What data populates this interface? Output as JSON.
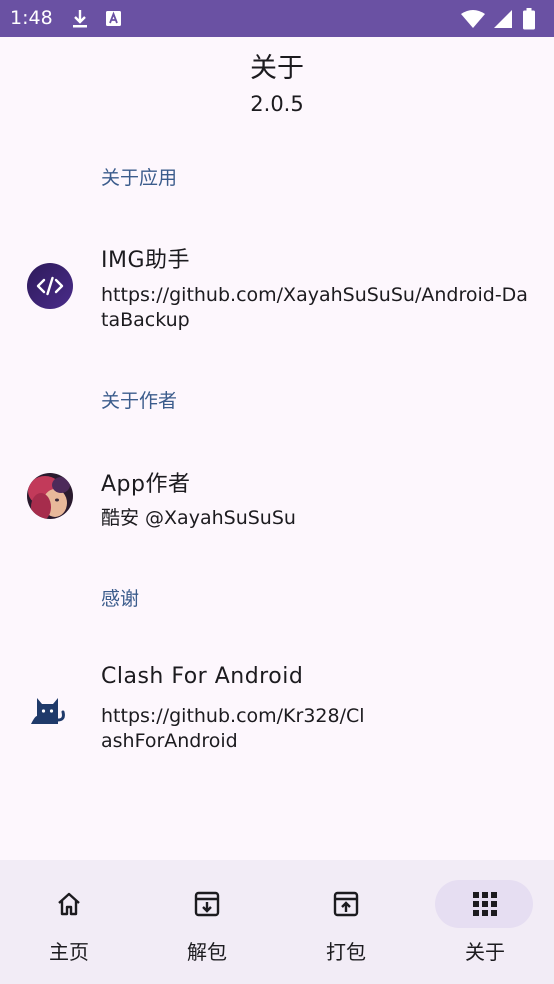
{
  "status_bar": {
    "time": "1:48"
  },
  "header": {
    "title": "关于",
    "version": "2.0.5"
  },
  "sections": [
    {
      "title": "关于应用",
      "item": {
        "title": "IMG助手",
        "subtitle": "https://github.com/XayahSuSuSu/Android-DataBackup",
        "icon": "code-brackets-icon"
      }
    },
    {
      "title": "关于作者",
      "item": {
        "title": "App作者",
        "subtitle": "酷安 @XayahSuSuSu",
        "icon": "author-avatar"
      }
    },
    {
      "title": "感谢",
      "item": {
        "title": "Clash For Android",
        "subtitle": "https://github.com/Kr328/ClashForAndroid",
        "icon": "cat-icon"
      }
    }
  ],
  "bottom_nav": [
    {
      "label": "主页",
      "icon": "home-icon",
      "active": false
    },
    {
      "label": "解包",
      "icon": "archive-down-icon",
      "active": false
    },
    {
      "label": "打包",
      "icon": "archive-up-icon",
      "active": false
    },
    {
      "label": "关于",
      "icon": "apps-grid-icon",
      "active": true
    }
  ],
  "colors": {
    "status_bar": "#6a51a3",
    "section_title": "#3b5c8c",
    "nav_active_pill": "#e6def2"
  }
}
